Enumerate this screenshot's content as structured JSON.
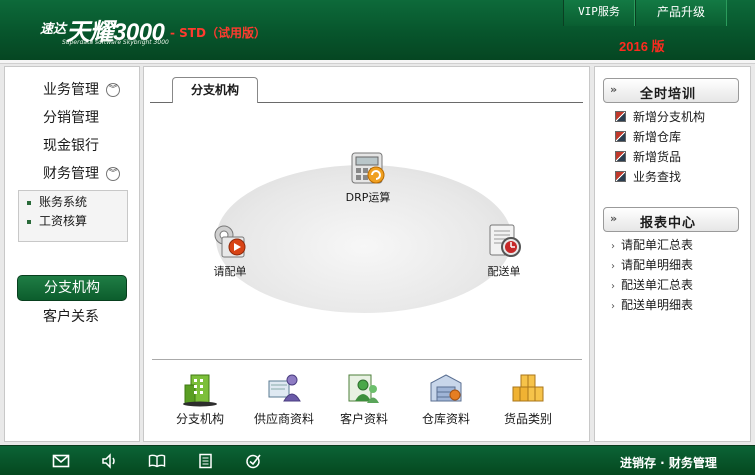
{
  "header": {
    "logo_cn": "速达",
    "logo_main": "天耀3000",
    "logo_edition": "- STD（试用版）",
    "logo_sub": "Superdata software Skybright 3000",
    "buttons": [
      "VIP服务",
      "产品升级"
    ],
    "year_badge": "2016 版"
  },
  "sidebar": {
    "items": [
      {
        "label": "业务管理",
        "toggle": "expand-down"
      },
      {
        "label": "分销管理"
      },
      {
        "label": "现金银行"
      },
      {
        "label": "财务管理",
        "toggle": "expand-down"
      },
      {
        "label": "分支机构",
        "active": true
      },
      {
        "label": "客户关系"
      }
    ],
    "submenu": [
      "账务系统",
      "工资核算"
    ]
  },
  "main": {
    "tab": "分支机构",
    "flow": [
      {
        "label": "DRP运算",
        "icon": "drp-calc-icon"
      },
      {
        "label": "请配单",
        "icon": "request-order-icon"
      },
      {
        "label": "配送单",
        "icon": "delivery-order-icon"
      }
    ],
    "bottom": [
      {
        "label": "分支机构",
        "icon": "building-icon"
      },
      {
        "label": "供应商资料",
        "icon": "supplier-icon"
      },
      {
        "label": "客户资料",
        "icon": "customer-icon"
      },
      {
        "label": "仓库资料",
        "icon": "warehouse-icon"
      },
      {
        "label": "货品类别",
        "icon": "goods-boxes-icon"
      }
    ]
  },
  "right": {
    "training": {
      "title": "全时培训",
      "links": [
        "新增分支机构",
        "新增仓库",
        "新增货品",
        "业务查找"
      ]
    },
    "reports": {
      "title": "报表中心",
      "links": [
        "请配单汇总表",
        "请配单明细表",
        "配送单汇总表",
        "配送单明细表"
      ]
    }
  },
  "statusbar": {
    "icons": [
      "mail-icon",
      "speaker-icon",
      "book-icon",
      "document-icon",
      "check-circle-icon"
    ],
    "text": "进销存 · 财务管理"
  },
  "colors": {
    "header_green": "#07552c",
    "accent_red": "#ff2a1f",
    "active_nav": "#1f7d45"
  }
}
